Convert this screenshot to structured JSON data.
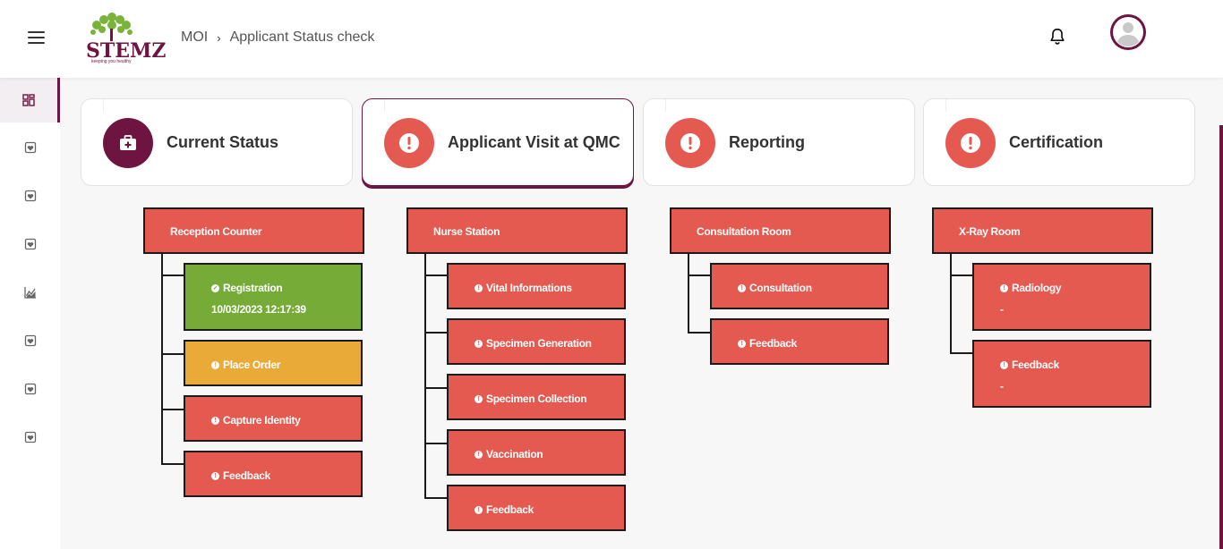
{
  "header": {
    "logo_text": "STEMZ",
    "logo_tagline": "keeping you healthy",
    "breadcrumb": [
      "MOI",
      "Applicant Status check"
    ]
  },
  "icons": {
    "menu": "hamburger-icon",
    "notifications": "bell-icon",
    "profile": "user-avatar-icon",
    "sidebar": [
      "dashboard-icon",
      "shield-heart-icon",
      "shield-heart-icon",
      "shield-heart-icon",
      "chart-icon",
      "shield-heart-icon",
      "shield-heart-icon",
      "shield-heart-icon"
    ]
  },
  "colors": {
    "brand": "#6e1440",
    "pending": "#e45a50",
    "done": "#75ab36",
    "in_progress": "#eaaa38"
  },
  "tabs": [
    {
      "label": "Current Status",
      "icon": "medical-kit-icon",
      "status": "completed"
    },
    {
      "label": "Applicant Visit at QMC",
      "icon": "alert-icon",
      "status": "pending",
      "selected": true
    },
    {
      "label": "Reporting",
      "icon": "alert-icon",
      "status": "pending"
    },
    {
      "label": "Certification",
      "icon": "alert-icon",
      "status": "pending"
    }
  ],
  "stations": [
    {
      "title": "Reception Counter",
      "steps": [
        {
          "label": "Registration",
          "detail": "10/03/2023 12:17:39",
          "status": "done"
        },
        {
          "label": "Place Order",
          "status": "in_progress"
        },
        {
          "label": "Capture Identity",
          "status": "pending"
        },
        {
          "label": "Feedback",
          "status": "pending"
        }
      ]
    },
    {
      "title": "Nurse Station",
      "steps": [
        {
          "label": "Vital Informations",
          "status": "pending"
        },
        {
          "label": "Specimen Generation",
          "status": "pending"
        },
        {
          "label": "Specimen Collection",
          "status": "pending"
        },
        {
          "label": "Vaccination",
          "status": "pending"
        },
        {
          "label": "Feedback",
          "status": "pending"
        }
      ]
    },
    {
      "title": "Consultation Room",
      "steps": [
        {
          "label": "Consultation",
          "status": "pending"
        },
        {
          "label": "Feedback",
          "status": "pending"
        }
      ]
    },
    {
      "title": "X-Ray Room",
      "steps": [
        {
          "label": "Radiology",
          "detail": "-",
          "status": "pending"
        },
        {
          "label": "Feedback",
          "detail": "-",
          "status": "pending"
        }
      ]
    }
  ]
}
